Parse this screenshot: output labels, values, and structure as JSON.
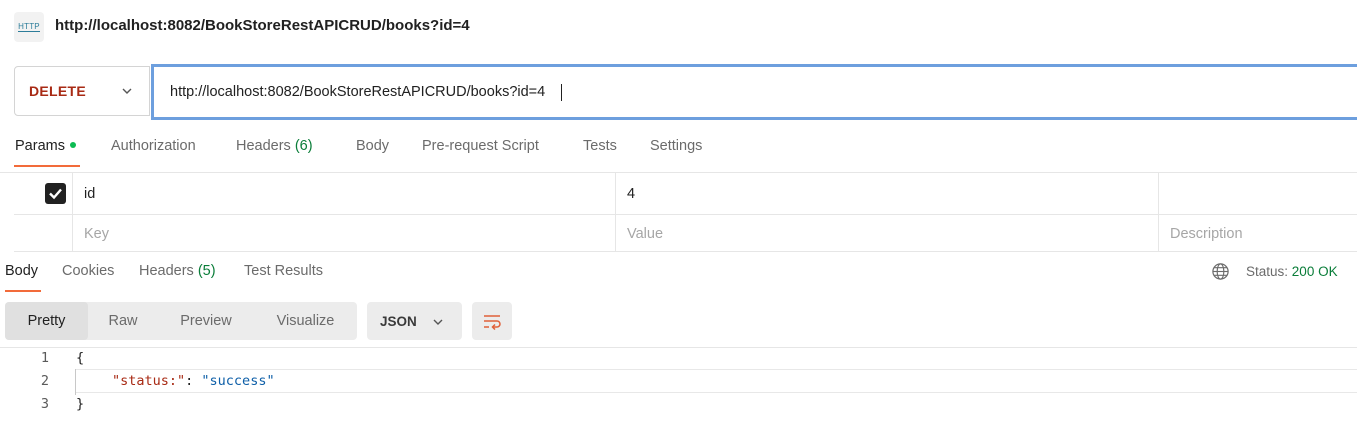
{
  "header": {
    "icon": "http-file-icon",
    "icon_text": "HTTP",
    "title": "http://localhost:8082/BookStoreRestAPICRUD/books?id=4"
  },
  "request": {
    "method": "DELETE",
    "method_color": "#a82a14",
    "url": "http://localhost:8082/BookStoreRestAPICRUD/books?id=4"
  },
  "request_tabs": {
    "params": "Params",
    "authorization": "Authorization",
    "headers": "Headers",
    "headers_count": "(6)",
    "body": "Body",
    "pre_request": "Pre-request Script",
    "tests": "Tests",
    "settings": "Settings"
  },
  "params": {
    "rows": [
      {
        "checked": true,
        "key": "id",
        "value": "4",
        "description": ""
      }
    ],
    "placeholders": {
      "key": "Key",
      "value": "Value",
      "description": "Description"
    }
  },
  "response_tabs": {
    "body": "Body",
    "cookies": "Cookies",
    "headers": "Headers",
    "headers_count": "(5)",
    "test_results": "Test Results"
  },
  "status": {
    "label": "Status:",
    "value": "200 OK",
    "color": "#0a7d39"
  },
  "view_modes": {
    "pretty": "Pretty",
    "raw": "Raw",
    "preview": "Preview",
    "visualize": "Visualize",
    "selected": "Pretty"
  },
  "format": {
    "selected": "JSON"
  },
  "code": {
    "line_numbers": [
      "1",
      "2",
      "3"
    ],
    "open_brace": "{",
    "key": "\"status:\"",
    "separator": ": ",
    "value": "\"success\"",
    "close_brace": "}"
  },
  "accent_color": "#f26b3a"
}
